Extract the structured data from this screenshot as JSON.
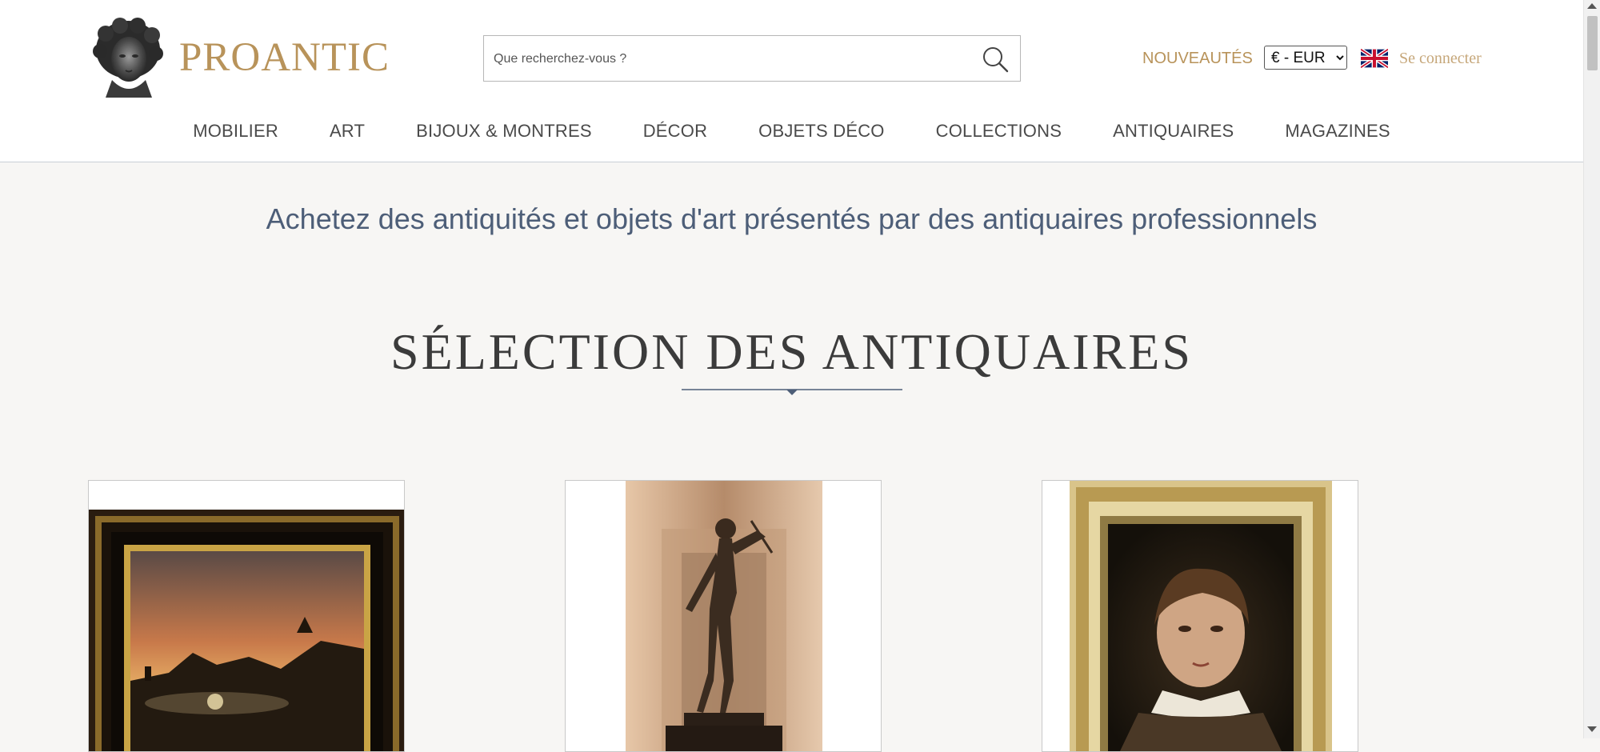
{
  "header": {
    "logo_text": "PROANTIC",
    "search_placeholder": "Que recherchez-vous ?",
    "nouveautes": "NOUVEAUTÉS",
    "currency_selected": "€ - EUR",
    "login": "Se connecter"
  },
  "nav": [
    "MOBILIER",
    "ART",
    "BIJOUX & MONTRES",
    "DÉCOR",
    "OBJETS DÉCO",
    "COLLECTIONS",
    "ANTIQUAIRES",
    "MAGAZINES"
  ],
  "main": {
    "tagline": "Achetez des antiquités et objets d'art présentés par des antiquaires professionnels",
    "section_title": "SÉLECTION DES ANTIQUAIRES"
  },
  "colors": {
    "brand_gold": "#b8935a",
    "login_gold": "#c6a77a",
    "tagline_blue": "#4d5e78",
    "background": "#f7f6f4"
  },
  "icons": [
    "search-icon",
    "uk-flag-icon",
    "logo-bust-icon",
    "title-divider-icon"
  ]
}
